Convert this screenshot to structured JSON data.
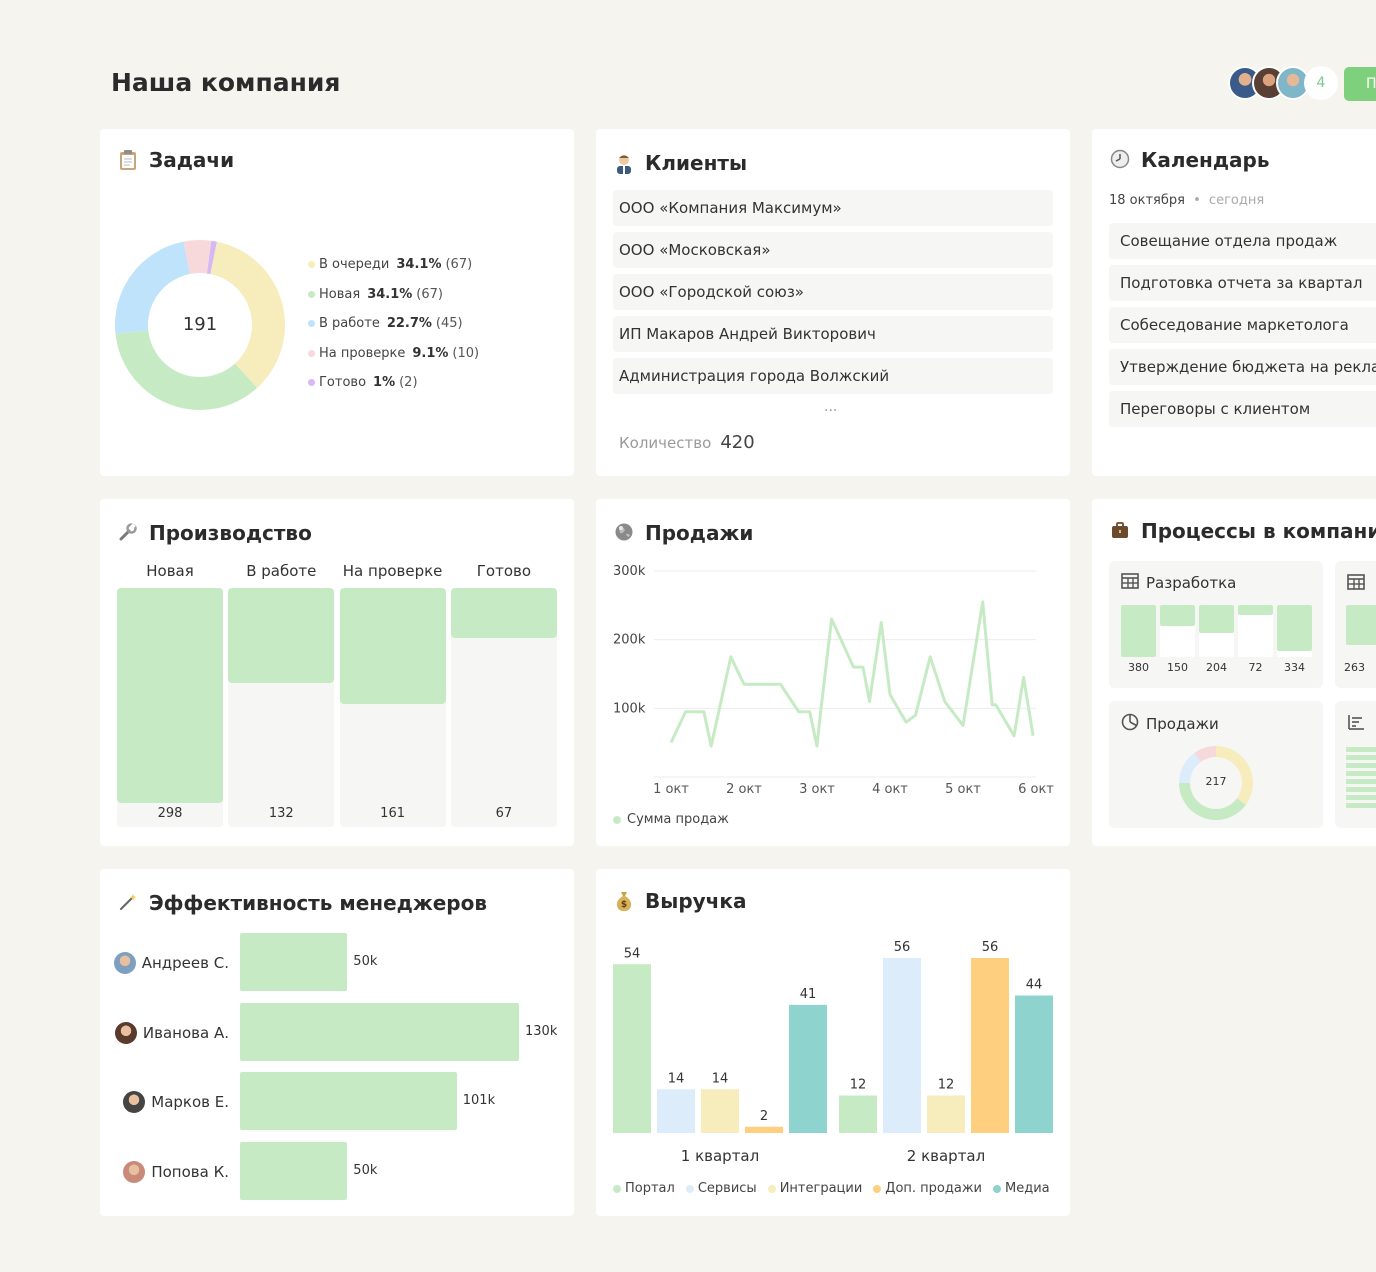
{
  "page": {
    "title": "Наша компания",
    "participants_count": "4",
    "action_button_label": "П"
  },
  "tasks": {
    "title": "Задачи",
    "total": "191",
    "legend": [
      {
        "label": "В очереди",
        "percent": "34.1%",
        "count": "(67)",
        "color": "#f6ecbc",
        "value": 67
      },
      {
        "label": "Новая",
        "percent": "34.1%",
        "count": "(67)",
        "color": "#c6ebc4",
        "value": 67
      },
      {
        "label": "В работе",
        "percent": "22.7%",
        "count": "(45)",
        "color": "#bfe3fa",
        "value": 45
      },
      {
        "label": "На проверке",
        "percent": "9.1%",
        "count": "(10)",
        "color": "#f7d9dc",
        "value": 10
      },
      {
        "label": "Готово",
        "percent": "1%",
        "count": "(2)",
        "color": "#d6b8f4",
        "value": 2
      }
    ]
  },
  "clients": {
    "title": "Клиенты",
    "items": [
      "ООО «Компания Максимум»",
      "ООО «Московская»",
      "ООО «Городской союз»",
      "ИП Макаров Андрей Викторович",
      "Администрация города Волжский"
    ],
    "more": "...",
    "count_label": "Количество",
    "count_value": "420"
  },
  "calendar": {
    "title": "Календарь",
    "date": "18 октября",
    "separator": "•",
    "today": "сегодня",
    "events": [
      "Совещание отдела продаж",
      "Подготовка отчета за квартал",
      "Собеседование маркетолога",
      "Утверждение бюджета на рекламу",
      "Переговоры с клиентом"
    ]
  },
  "production": {
    "title": "Производство",
    "max": 298,
    "columns": [
      {
        "label": "Новая",
        "value": 298,
        "display": "298"
      },
      {
        "label": "В работе",
        "value": 132,
        "display": "132"
      },
      {
        "label": "На проверке",
        "value": 161,
        "display": "161"
      },
      {
        "label": "Готово",
        "value": 67,
        "display": "67"
      }
    ]
  },
  "sales": {
    "title": "Продажи",
    "legend": "Сумма продаж",
    "color": "#c6ebc4",
    "chart_data": {
      "type": "line",
      "title": "Продажи",
      "xlabel": "",
      "ylabel": "",
      "ylim": [
        0,
        300000
      ],
      "y_ticks": [
        "300k",
        "200k",
        "100k"
      ],
      "y_tick_values": [
        300000,
        200000,
        100000
      ],
      "x_ticks": [
        "1 окт",
        "2 окт",
        "3 окт",
        "4 окт",
        "5 окт",
        "6 окт"
      ],
      "x_tick_positions": [
        0,
        1,
        2,
        3,
        4,
        5
      ],
      "series": [
        {
          "name": "Сумма продаж",
          "x": [
            0,
            0.2,
            0.45,
            0.55,
            0.82,
            1.0,
            1.3,
            1.5,
            1.75,
            1.9,
            2.0,
            2.05,
            2.2,
            2.5,
            2.63,
            2.72,
            2.88,
            3.0,
            3.22,
            3.35,
            3.55,
            3.75,
            4.0,
            4.27,
            4.4,
            4.45,
            4.7,
            4.83,
            4.96
          ],
          "y": [
            50000,
            95000,
            95000,
            45000,
            175000,
            135000,
            135000,
            135000,
            95000,
            95000,
            45000,
            95000,
            230000,
            160000,
            160000,
            110000,
            225000,
            120000,
            80000,
            90000,
            175000,
            110000,
            75000,
            255000,
            105000,
            105000,
            60000,
            145000,
            60000
          ]
        }
      ]
    }
  },
  "processes": {
    "title": "Процессы в компании",
    "dev": {
      "title": "Разработка",
      "bars": [
        {
          "label": "380",
          "value": 380
        },
        {
          "label": "150",
          "value": 150
        },
        {
          "label": "204",
          "value": 204
        },
        {
          "label": "72",
          "value": 72
        },
        {
          "label": "334",
          "value": 334
        }
      ],
      "max": 380
    },
    "second_label": "263",
    "sales": {
      "title": "Продажи",
      "total": "217",
      "segments": [
        {
          "color": "#f6ecbc",
          "value": 35
        },
        {
          "color": "#c6ebc4",
          "value": 40
        },
        {
          "color": "#dcecfb",
          "value": 15
        },
        {
          "color": "#f7d9dc",
          "value": 10
        }
      ]
    }
  },
  "managers": {
    "title": "Эффективность менеджеров",
    "max": 130,
    "items": [
      {
        "name": "Андреев С.",
        "value": 50,
        "display": "50k"
      },
      {
        "name": "Иванова А.",
        "value": 130,
        "display": "130k"
      },
      {
        "name": "Марков Е.",
        "value": 101,
        "display": "101k"
      },
      {
        "name": "Попова К.",
        "value": 50,
        "display": "50k"
      }
    ]
  },
  "revenue": {
    "title": "Выручка",
    "chart_data": {
      "type": "bar",
      "title": "Выручка",
      "categories": [
        "1 квартал",
        "2 квартал"
      ],
      "ylim": [
        0,
        60
      ],
      "series": [
        {
          "name": "Портал",
          "color": "#c6ebc4",
          "values": [
            54,
            12
          ]
        },
        {
          "name": "Сервисы",
          "color": "#dcecfb",
          "values": [
            14,
            56
          ]
        },
        {
          "name": "Интеграции",
          "color": "#f6ecbc",
          "values": [
            14,
            12
          ]
        },
        {
          "name": "Доп. продажи",
          "color": "#ffcf80",
          "values": [
            2,
            56
          ]
        },
        {
          "name": "Медиа",
          "color": "#8fd3cf",
          "values": [
            41,
            44
          ]
        }
      ]
    }
  }
}
